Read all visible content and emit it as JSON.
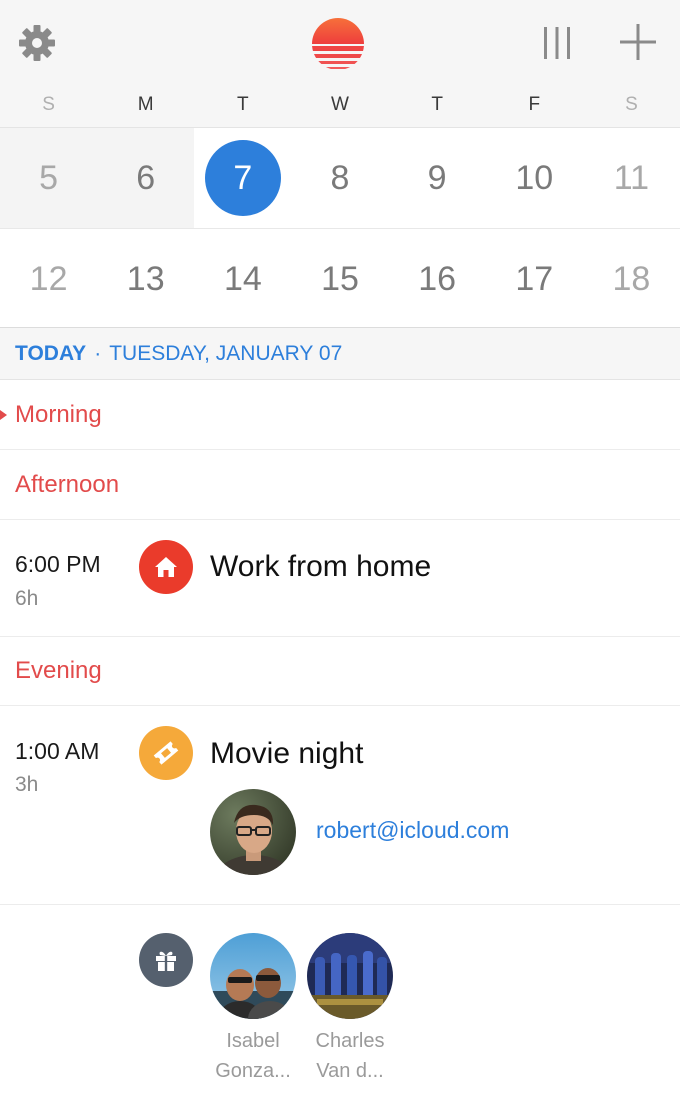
{
  "colors": {
    "accent_blue": "#2d7fdb",
    "section_red": "#e24b4b",
    "home_icon_red": "#ea3b2b",
    "ticket_icon_orange": "#f5a93a",
    "gift_icon_slate": "#55606e",
    "header_bg": "#f6f6f6"
  },
  "header": {
    "settings_icon": "gear-icon",
    "logo_icon": "sunrise-logo",
    "view_icon": "columns-icon",
    "add_icon": "plus-icon"
  },
  "weekdays": [
    "S",
    "M",
    "T",
    "W",
    "T",
    "F",
    "S"
  ],
  "calendar": {
    "week1": [
      "5",
      "6",
      "7",
      "8",
      "9",
      "10",
      "11"
    ],
    "week2": [
      "12",
      "13",
      "14",
      "15",
      "16",
      "17",
      "18"
    ],
    "today": "7"
  },
  "date_banner": {
    "today_label": "TODAY",
    "separator": "·",
    "date_text": "TUESDAY, JANUARY 07"
  },
  "agenda": {
    "morning": "Morning",
    "afternoon": "Afternoon",
    "evening": "Evening",
    "events": [
      {
        "time": "6:00 PM",
        "duration": "6h",
        "title": "Work from home",
        "icon": "home-icon"
      },
      {
        "time": "1:00 AM",
        "duration": "3h",
        "title": "Movie night",
        "icon": "ticket-icon",
        "attendee_email": "robert@icloud.com"
      }
    ],
    "birthdays": {
      "icon": "gift-icon",
      "people": [
        {
          "line1": "Isabel",
          "line2": "Gonza..."
        },
        {
          "line1": "Charles",
          "line2": "Van d..."
        }
      ]
    }
  }
}
